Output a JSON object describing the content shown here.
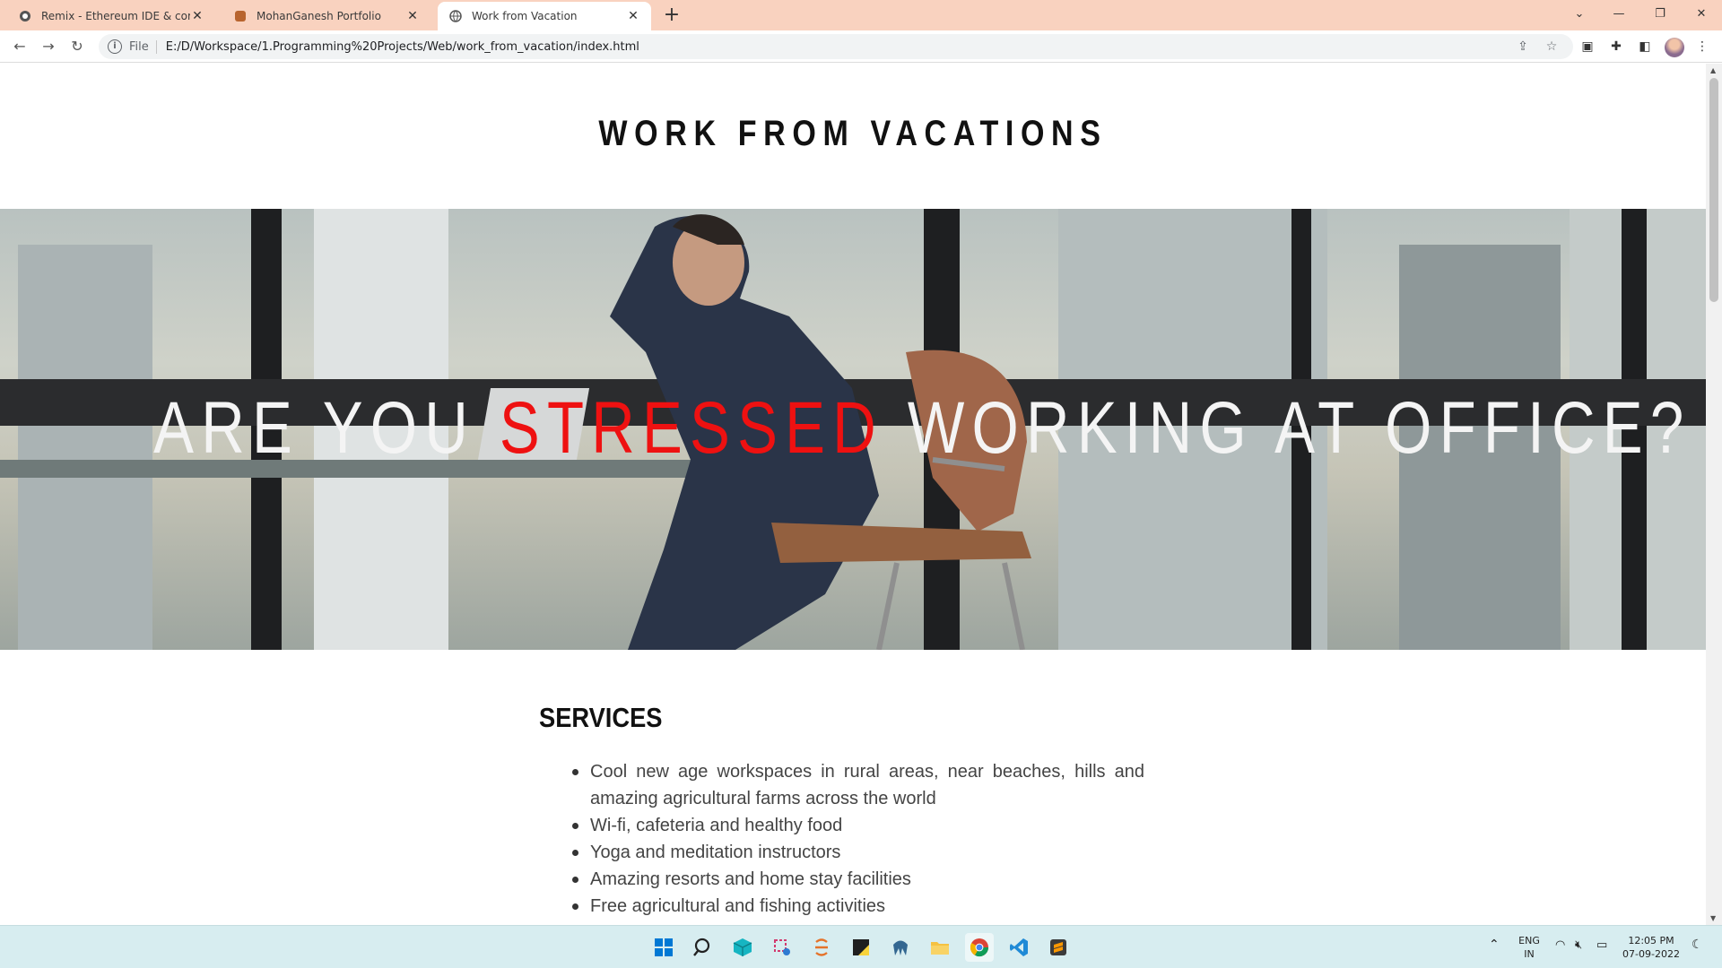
{
  "browser": {
    "tabs": [
      {
        "title": "Remix - Ethereum IDE & commu",
        "favicon": "remix-icon",
        "active": false
      },
      {
        "title": "MohanGanesh Portfolio",
        "favicon": "portfolio-icon",
        "active": false
      },
      {
        "title": "Work from Vacation",
        "favicon": "globe-icon",
        "active": true
      }
    ],
    "new_tab_label": "+",
    "address": {
      "scheme_label": "File",
      "url": "E:/D/Workspace/1.Programming%20Projects/Web/work_from_vacation/index.html"
    }
  },
  "page": {
    "site_title": "WORK FROM VACATIONS",
    "hero": {
      "text_before": "ARE YOU ",
      "text_highlight": "STRESSED",
      "text_after": " WORKING AT OFFICE?",
      "highlight_color": "#ee1111"
    },
    "services": {
      "title": "SERVICES",
      "items": [
        "Cool new age workspaces in rural areas, near beaches, hills and amazing agricultural farms across the world",
        "Wi-fi, cafeteria and healthy food",
        "Yoga and meditation instructors",
        "Amazing resorts and home stay facilities",
        "Free agricultural and fishing activities"
      ]
    }
  },
  "taskbar": {
    "apps": [
      "windows-start-icon",
      "search-icon",
      "3d-cube-icon",
      "snipping-tool-icon",
      "eclipse-icon",
      "sticky-notes-icon",
      "database-icon",
      "file-explorer-icon",
      "chrome-icon",
      "vscode-icon",
      "sublime-icon"
    ],
    "language": {
      "line1": "ENG",
      "line2": "IN"
    },
    "clock": {
      "time": "12:05 PM",
      "date": "07-09-2022"
    }
  }
}
